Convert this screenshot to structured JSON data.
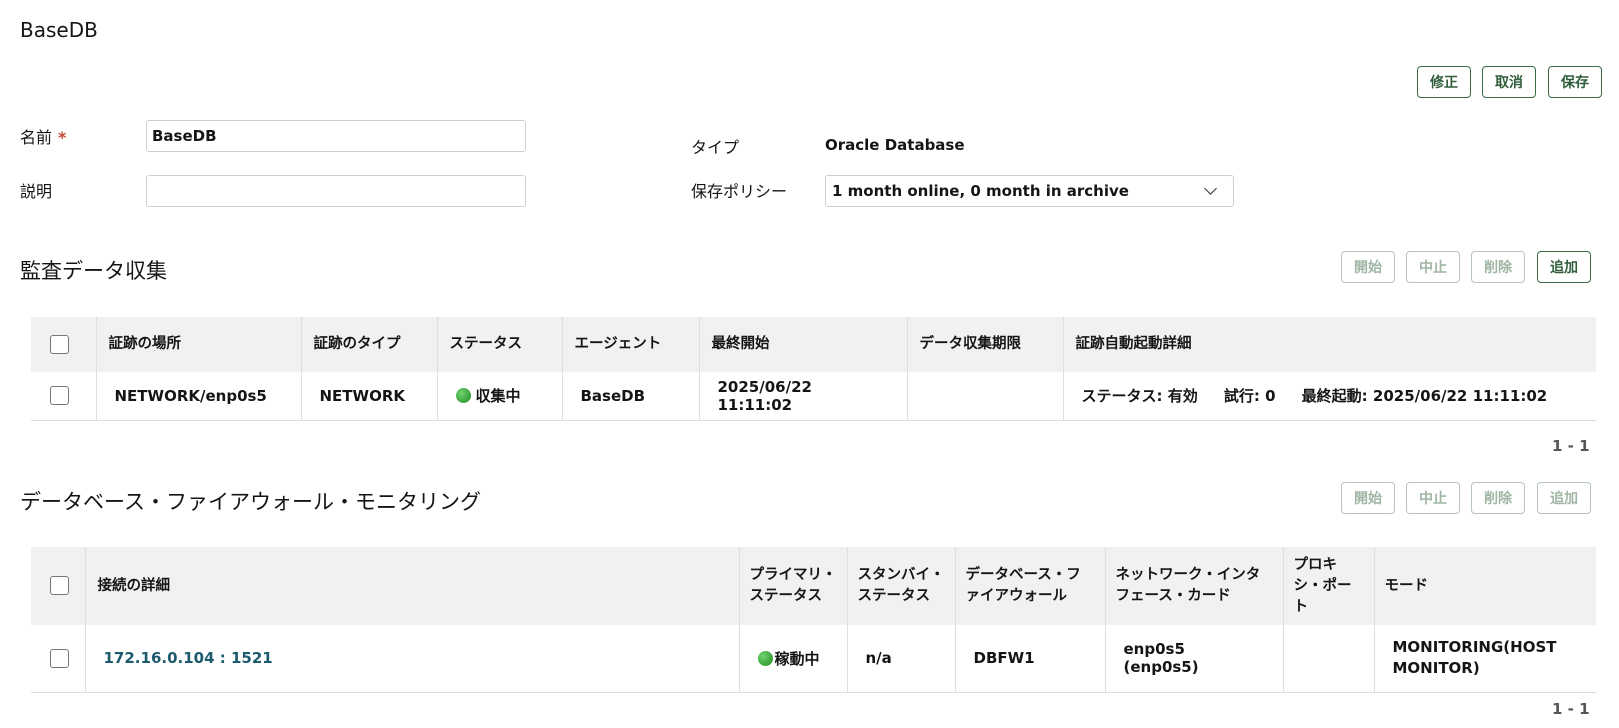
{
  "page": {
    "title": "BaseDB"
  },
  "toolbar": {
    "edit": "修正",
    "cancel": "取消",
    "save": "保存"
  },
  "form": {
    "name_label": "名前",
    "required_mark": "*",
    "name_value": "BaseDB",
    "description_label": "説明",
    "description_value": "",
    "type_label": "タイプ",
    "type_value": "Oracle Database",
    "retention_label": "保存ポリシー",
    "retention_value": "1 month online, 0 month in archive"
  },
  "audit": {
    "title": "監査データ収集",
    "buttons": {
      "start": "開始",
      "stop": "中止",
      "delete": "削除",
      "add": "追加"
    },
    "columns": [
      "証跡の場所",
      "証跡のタイプ",
      "ステータス",
      "エージェント",
      "最終開始",
      "データ収集期限",
      "証跡自動起動詳細"
    ],
    "row": {
      "location": "NETWORK/enp0s5",
      "type": "NETWORK",
      "status": "収集中",
      "agent": "BaseDB",
      "last_start": "2025/06/22 11:11:02",
      "deadline": "",
      "auto_status_label": "ステータス:",
      "auto_status_value": "有効",
      "auto_try_label": "試行:",
      "auto_try_value": "0",
      "auto_last_label": "最終起動:",
      "auto_last_value": "2025/06/22 11:11:02"
    },
    "pager": "1 - 1"
  },
  "firewall": {
    "title": "データベース・ファイアウォール・モニタリング",
    "buttons": {
      "start": "開始",
      "stop": "中止",
      "delete": "削除",
      "add": "追加"
    },
    "columns": [
      "接続の詳細",
      "プライマリ・ステータス",
      "スタンバイ・ステータス",
      "データベース・ファイアウォール",
      "ネットワーク・インタフェース・カード",
      "プロキシ・ポート",
      "モード"
    ],
    "row": {
      "connection": "172.16.0.104 : 1521",
      "primary_status": "稼動中",
      "standby_status": "n/a",
      "firewall": "DBFW1",
      "nic": "enp0s5 (enp0s5)",
      "proxy_port": "",
      "mode": "MONITORING(HOST MONITOR)"
    },
    "pager": "1 - 1"
  },
  "colors": {
    "accent": "#2f5d3a",
    "header_bg": "#f1f1f1",
    "link": "#1d5a6e",
    "status_green": "#1e8a1e"
  }
}
